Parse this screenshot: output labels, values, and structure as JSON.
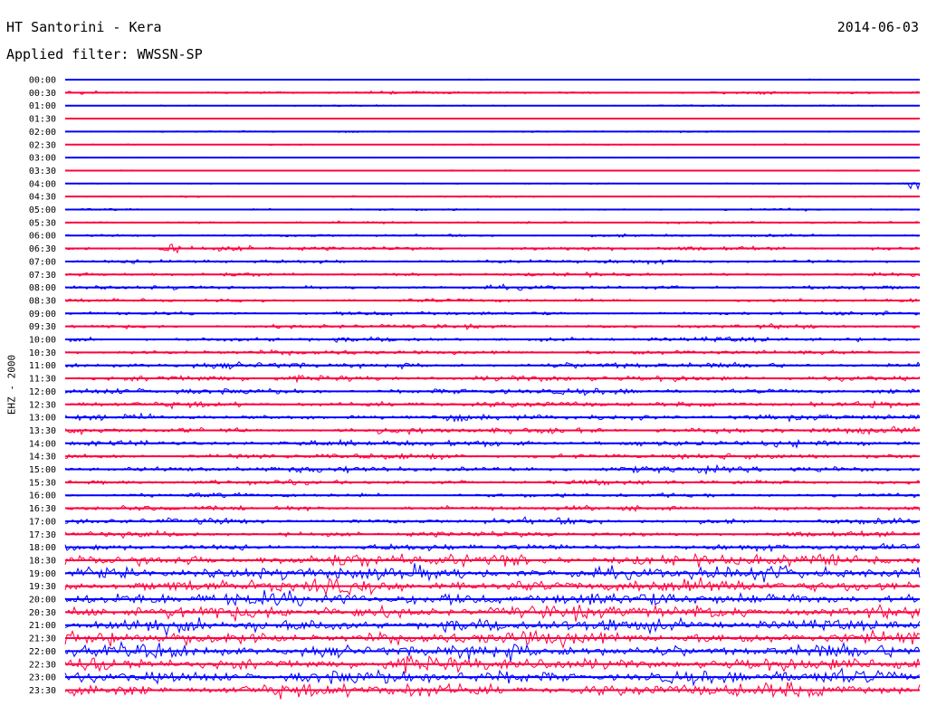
{
  "header": {
    "station": "HT Santorini - Kera",
    "date": "2014-06-03",
    "filter": "Applied filter: WWSSN-SP"
  },
  "channel_label": "EHZ - 2000",
  "colors": {
    "blue": "#0000ff",
    "red": "#ff0040"
  },
  "chart_data": {
    "type": "line",
    "title": "HT Santorini - Kera",
    "subtitle": "Applied filter: WWSSN-SP",
    "ylabel": "EHZ - 2000",
    "row_labels": [
      "00:00",
      "00:30",
      "01:00",
      "01:30",
      "02:00",
      "02:30",
      "03:00",
      "03:30",
      "04:00",
      "04:30",
      "05:00",
      "05:30",
      "06:00",
      "06:30",
      "07:00",
      "07:30",
      "08:00",
      "08:30",
      "09:00",
      "09:30",
      "10:00",
      "10:30",
      "11:00",
      "11:30",
      "12:00",
      "12:30",
      "13:00",
      "13:30",
      "14:00",
      "14:30",
      "15:00",
      "15:30",
      "16:00",
      "16:30",
      "17:00",
      "17:30",
      "18:00",
      "18:30",
      "19:00",
      "19:30",
      "20:00",
      "20:30",
      "21:00",
      "21:30",
      "22:00",
      "22:30",
      "23:00",
      "23:30"
    ],
    "row_colors": [
      "blue",
      "red"
    ],
    "relative_noise_amplitude": [
      0.6,
      1.5,
      0.8,
      0.6,
      0.9,
      0.7,
      0.6,
      0.7,
      0.7,
      0.9,
      1.2,
      1.4,
      1.6,
      2.4,
      2.2,
      2.0,
      2.2,
      2.0,
      2.1,
      2.3,
      2.6,
      2.6,
      3.2,
      3.4,
      3.2,
      3.2,
      3.4,
      3.4,
      3.5,
      3.2,
      3.6,
      2.7,
      2.4,
      2.8,
      3.2,
      3.0,
      3.6,
      7.0,
      7.5,
      7.5,
      7.5,
      7.5,
      7.5,
      7.5,
      7.5,
      7.5,
      7.5,
      7.5
    ],
    "events": [
      {
        "row": "04:00",
        "position": 0.995,
        "relative_amplitude": 8
      },
      {
        "row": "06:30",
        "position": 0.12,
        "relative_amplitude": 7
      }
    ]
  }
}
